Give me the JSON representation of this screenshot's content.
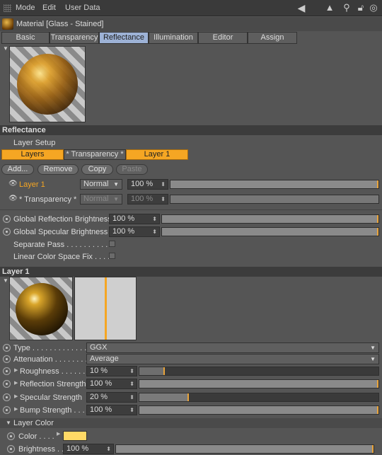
{
  "menu": {
    "mode": "Mode",
    "edit": "Edit",
    "user_data": "User Data"
  },
  "material": {
    "title": "Material [Glass - Stained]"
  },
  "tabs": [
    "Basic",
    "Transparency",
    "Reflectance",
    "Illumination",
    "Editor",
    "Assign"
  ],
  "active_tab": "Reflectance",
  "reflectance": {
    "header": "Reflectance",
    "layer_setup_label": "Layer Setup",
    "setup_tabs": [
      "Layers",
      "* Transparency *",
      "Layer 1"
    ],
    "buttons": {
      "add": "Add...",
      "remove": "Remove",
      "copy": "Copy",
      "paste": "Paste"
    },
    "layers": [
      {
        "name": "Layer 1",
        "mode": "Normal",
        "value": "100 %",
        "amount": 1.0
      },
      {
        "name": "* Transparency *",
        "mode": "Normal",
        "value": "100 %",
        "amount": 1.0
      }
    ],
    "global_reflection": {
      "label": "Global Reflection Brightness",
      "value": "100 %",
      "amount": 1.0
    },
    "global_specular": {
      "label": "Global Specular Brightness",
      "value": "100 %",
      "amount": 1.0
    },
    "separate_pass": "Separate Pass . . . . . . . . . . .",
    "linear_color_fix": "Linear Color Space Fix . . . . ."
  },
  "layer1": {
    "header": "Layer 1",
    "type": {
      "label": "Type . . . . . . . . . . . . . . .",
      "value": "GGX"
    },
    "attenuation": {
      "label": "Attenuation . . . . . . . .",
      "value": "Average"
    },
    "roughness": {
      "label": "Roughness . . . . . . .",
      "value": "10 %",
      "amount": 0.1
    },
    "reflection_strength": {
      "label": "Reflection Strength",
      "value": "100 %",
      "amount": 1.0
    },
    "specular_strength": {
      "label": "Specular Strength",
      "value": "20 %",
      "amount": 0.2
    },
    "bump_strength": {
      "label": "Bump Strength . . .",
      "value": "100 %",
      "amount": 1.0
    }
  },
  "layer_color": {
    "header": "Layer Color",
    "color_label": "Color . . . .",
    "color_value": "#ffd966",
    "brightness_label": "Brightness . .",
    "brightness_value": "100 %",
    "brightness_amount": 1.0
  },
  "colors": {
    "accent": "#f5a623",
    "active_tab": "#9db2d6"
  }
}
